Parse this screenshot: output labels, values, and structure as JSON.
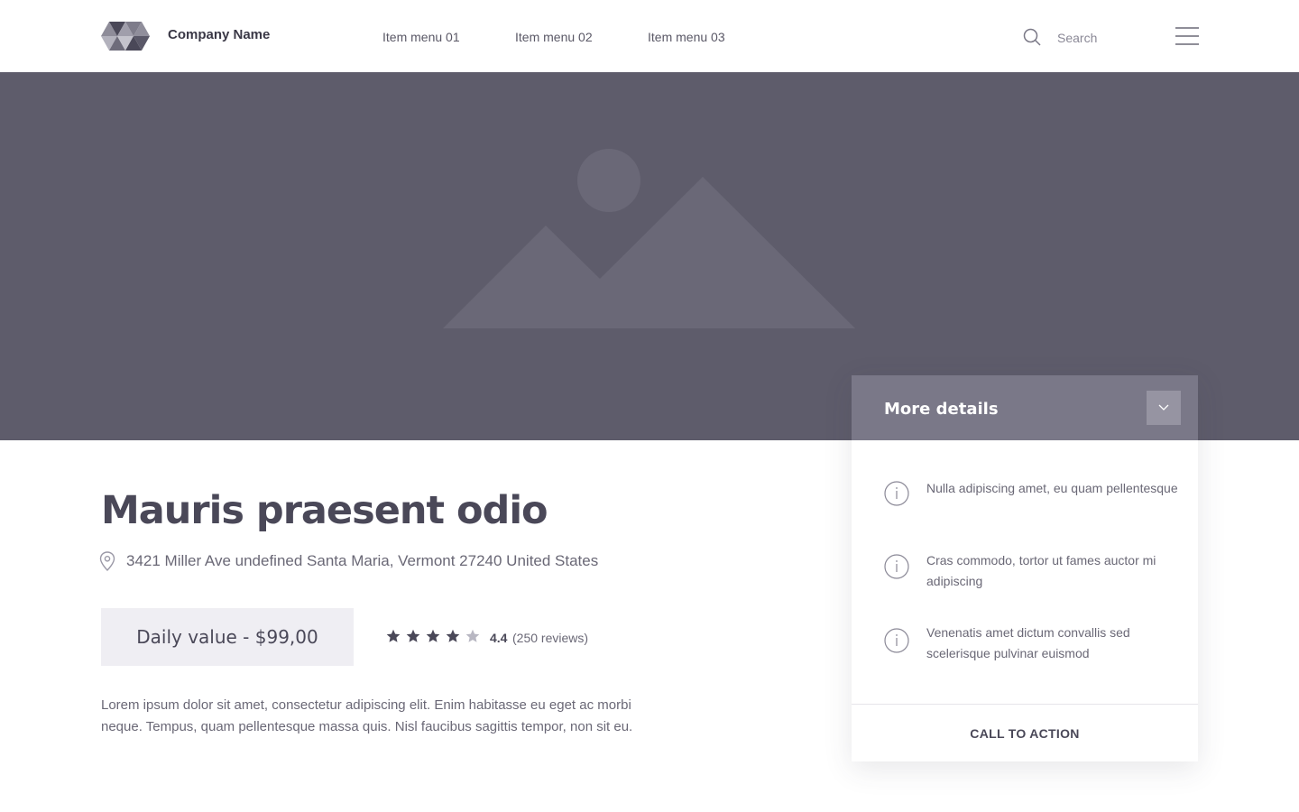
{
  "header": {
    "company_name": "Company Name",
    "nav": [
      "Item menu 01",
      "Item menu 02",
      "Item menu 03"
    ],
    "search_placeholder": "Search"
  },
  "listing": {
    "title": "Mauris praesent odio",
    "address": "3421 Miller Ave undefined Santa Maria, Vermont 27240 United States",
    "price": "Daily value - $99,00",
    "rating": {
      "value": "4.4",
      "reviews": "(250 reviews)",
      "stars_filled": 4,
      "stars_total": 5
    },
    "description": "Lorem ipsum dolor sit amet, consectetur adipiscing elit. Enim habitasse eu eget ac morbi neque. Tempus, quam pellentesque massa quis. Nisl faucibus sagittis tempor, non sit eu."
  },
  "details_card": {
    "title": "More details",
    "items": [
      "Nulla adipiscing amet, eu quam pellentesque",
      "Cras commodo, tortor ut fames auctor mi adipiscing",
      "Venenatis amet dictum convallis sed scelerisque pulvinar euismod"
    ],
    "cta": "CALL TO ACTION"
  },
  "colors": {
    "hero_bg": "#5e5c6b",
    "card_header": "#7a7888",
    "price_bg": "#efeef3",
    "text_dark": "#4a4858",
    "star_filled": "#4a4858",
    "star_empty": "#b8b7c2"
  },
  "icons": {
    "logo": "triangle-logo",
    "search": "search-icon",
    "menu": "hamburger-icon",
    "location": "map-pin-icon",
    "info": "info-icon",
    "toggle": "chevron-down-icon",
    "hero_image": "image-placeholder-icon"
  }
}
